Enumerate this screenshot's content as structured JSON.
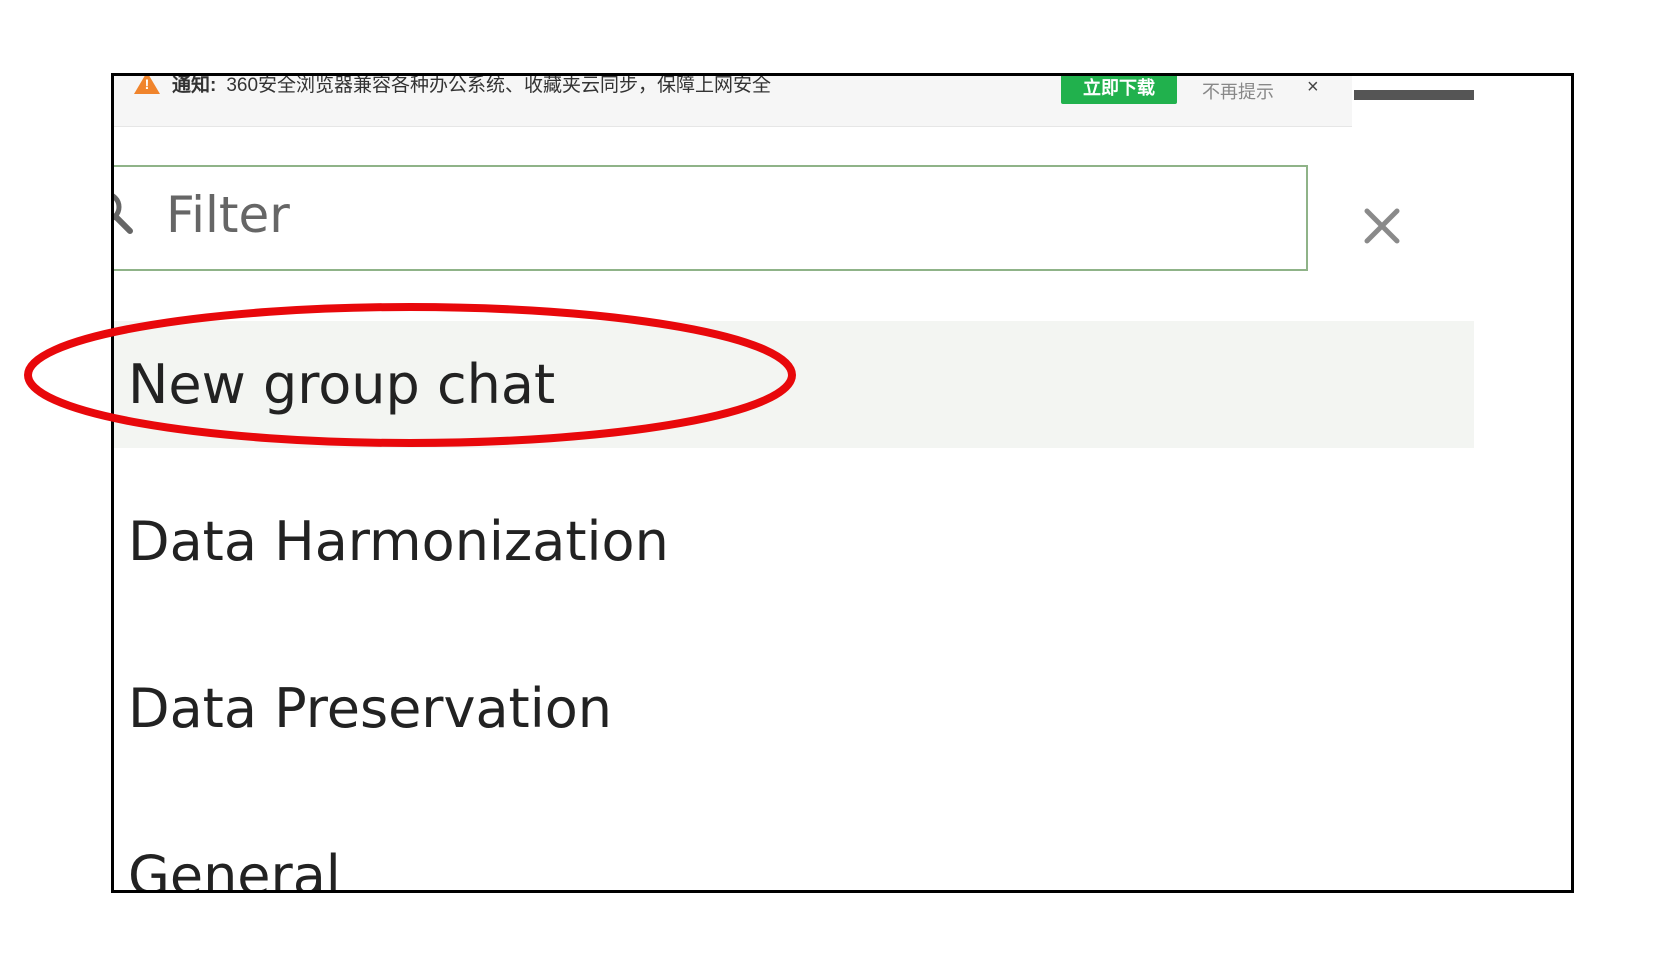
{
  "notification": {
    "label": "通知:",
    "message": "360安全浏览器兼容各种办公系统、收藏夹云同步，保障上网安全",
    "download_button": "立即下载",
    "dismiss_link": "不再提示",
    "close_glyph": "×",
    "warning_icon": "warning-triangle-icon",
    "accent_color": "#21b14d"
  },
  "filter": {
    "placeholder": "Filter",
    "value": "",
    "border_color": "#8fb388",
    "search_icon": "search-icon",
    "clear_icon": "close-icon"
  },
  "group_list": {
    "items": [
      {
        "label": "New group chat",
        "highlighted": true
      },
      {
        "label": "Data Harmonization",
        "highlighted": false
      },
      {
        "label": "Data Preservation",
        "highlighted": false
      },
      {
        "label": "General",
        "highlighted": false
      }
    ]
  },
  "annotation": {
    "target": "New group chat",
    "color": "#e8080b"
  }
}
